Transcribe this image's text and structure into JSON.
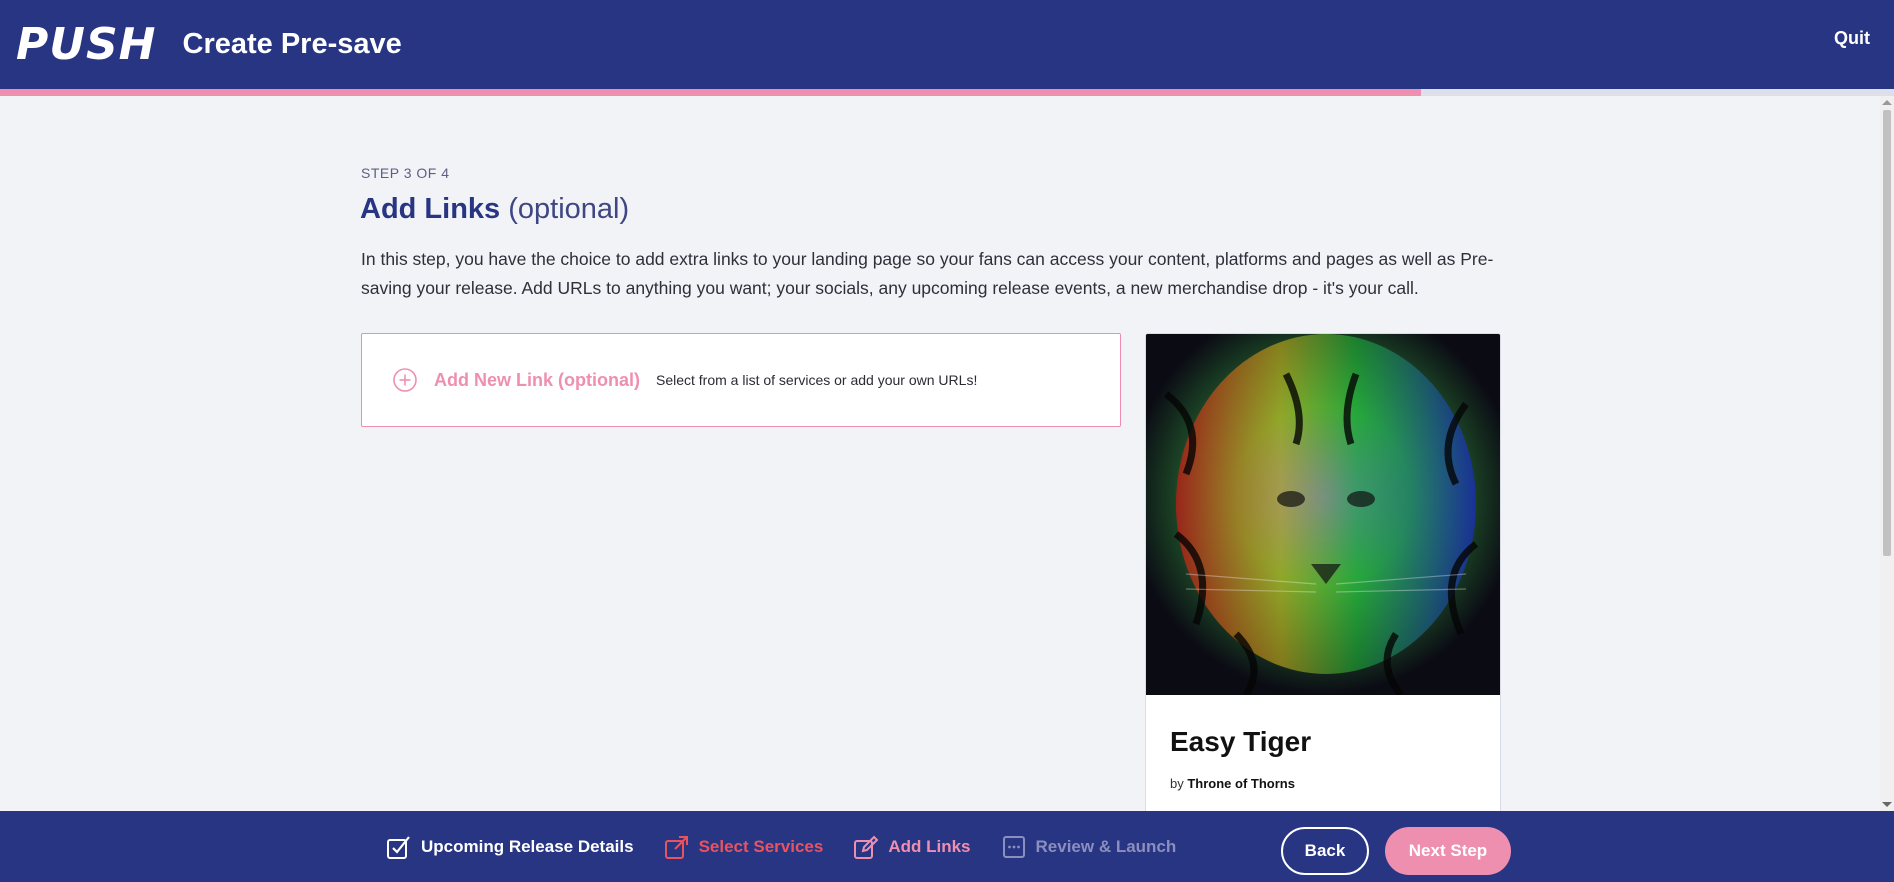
{
  "header": {
    "logo_text": "PUSH",
    "title": "Create Pre-save",
    "quit_label": "Quit",
    "progress_fraction": 0.75
  },
  "main": {
    "step_label": "STEP 3 OF 4",
    "heading_main": "Add Links",
    "heading_optional": "(optional)",
    "description": "In this step, you have the choice to add extra links to your landing page so your fans can access your content, platforms and pages as well as Pre-saving your release. Add URLs to anything you want; your socials, any upcoming release events, a new merchandise drop - it's your call.",
    "add_link": {
      "label": "Add New Link (optional)",
      "hint": "Select from a list of services or add your own URLs!"
    }
  },
  "preview": {
    "release_title": "Easy Tiger",
    "by_prefix": "by",
    "artist": "Throne of Thorns"
  },
  "footer": {
    "steps": [
      {
        "label": "Upcoming Release Details",
        "icon": "checkbox-icon",
        "state": "done"
      },
      {
        "label": "Select Services",
        "icon": "share-icon",
        "state": "services"
      },
      {
        "label": "Add Links",
        "icon": "edit-icon",
        "state": "active"
      },
      {
        "label": "Review & Launch",
        "icon": "dots-box-icon",
        "state": "pending"
      }
    ],
    "back_label": "Back",
    "next_label": "Next Step"
  },
  "colors": {
    "navy": "#283583",
    "pink": "#ef8fb0",
    "red": "#e8535f",
    "background": "#f2f3f7"
  }
}
